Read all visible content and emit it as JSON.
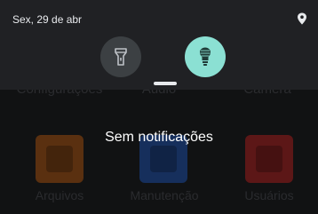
{
  "status_bar": {
    "date": "Sex, 29 de abr",
    "location_icon": "location-pin-icon"
  },
  "quick_settings": {
    "tiles": [
      {
        "icon": "flashlight-icon",
        "state": "off",
        "color": "#3c4043"
      },
      {
        "icon": "lightbulb-icon",
        "state": "on",
        "color": "#8be0d3"
      }
    ]
  },
  "notifications": {
    "empty_message": "Sem notificações"
  },
  "launcher": {
    "apps": [
      {
        "label": "Configurações"
      },
      {
        "label": "Áudio"
      },
      {
        "label": "Câmera"
      },
      {
        "label": "Arquivos",
        "color": "#6b3a13"
      },
      {
        "label": "Manutenção",
        "color": "#17356a"
      },
      {
        "label": "Usuários",
        "color": "#6a1b1b"
      }
    ]
  }
}
